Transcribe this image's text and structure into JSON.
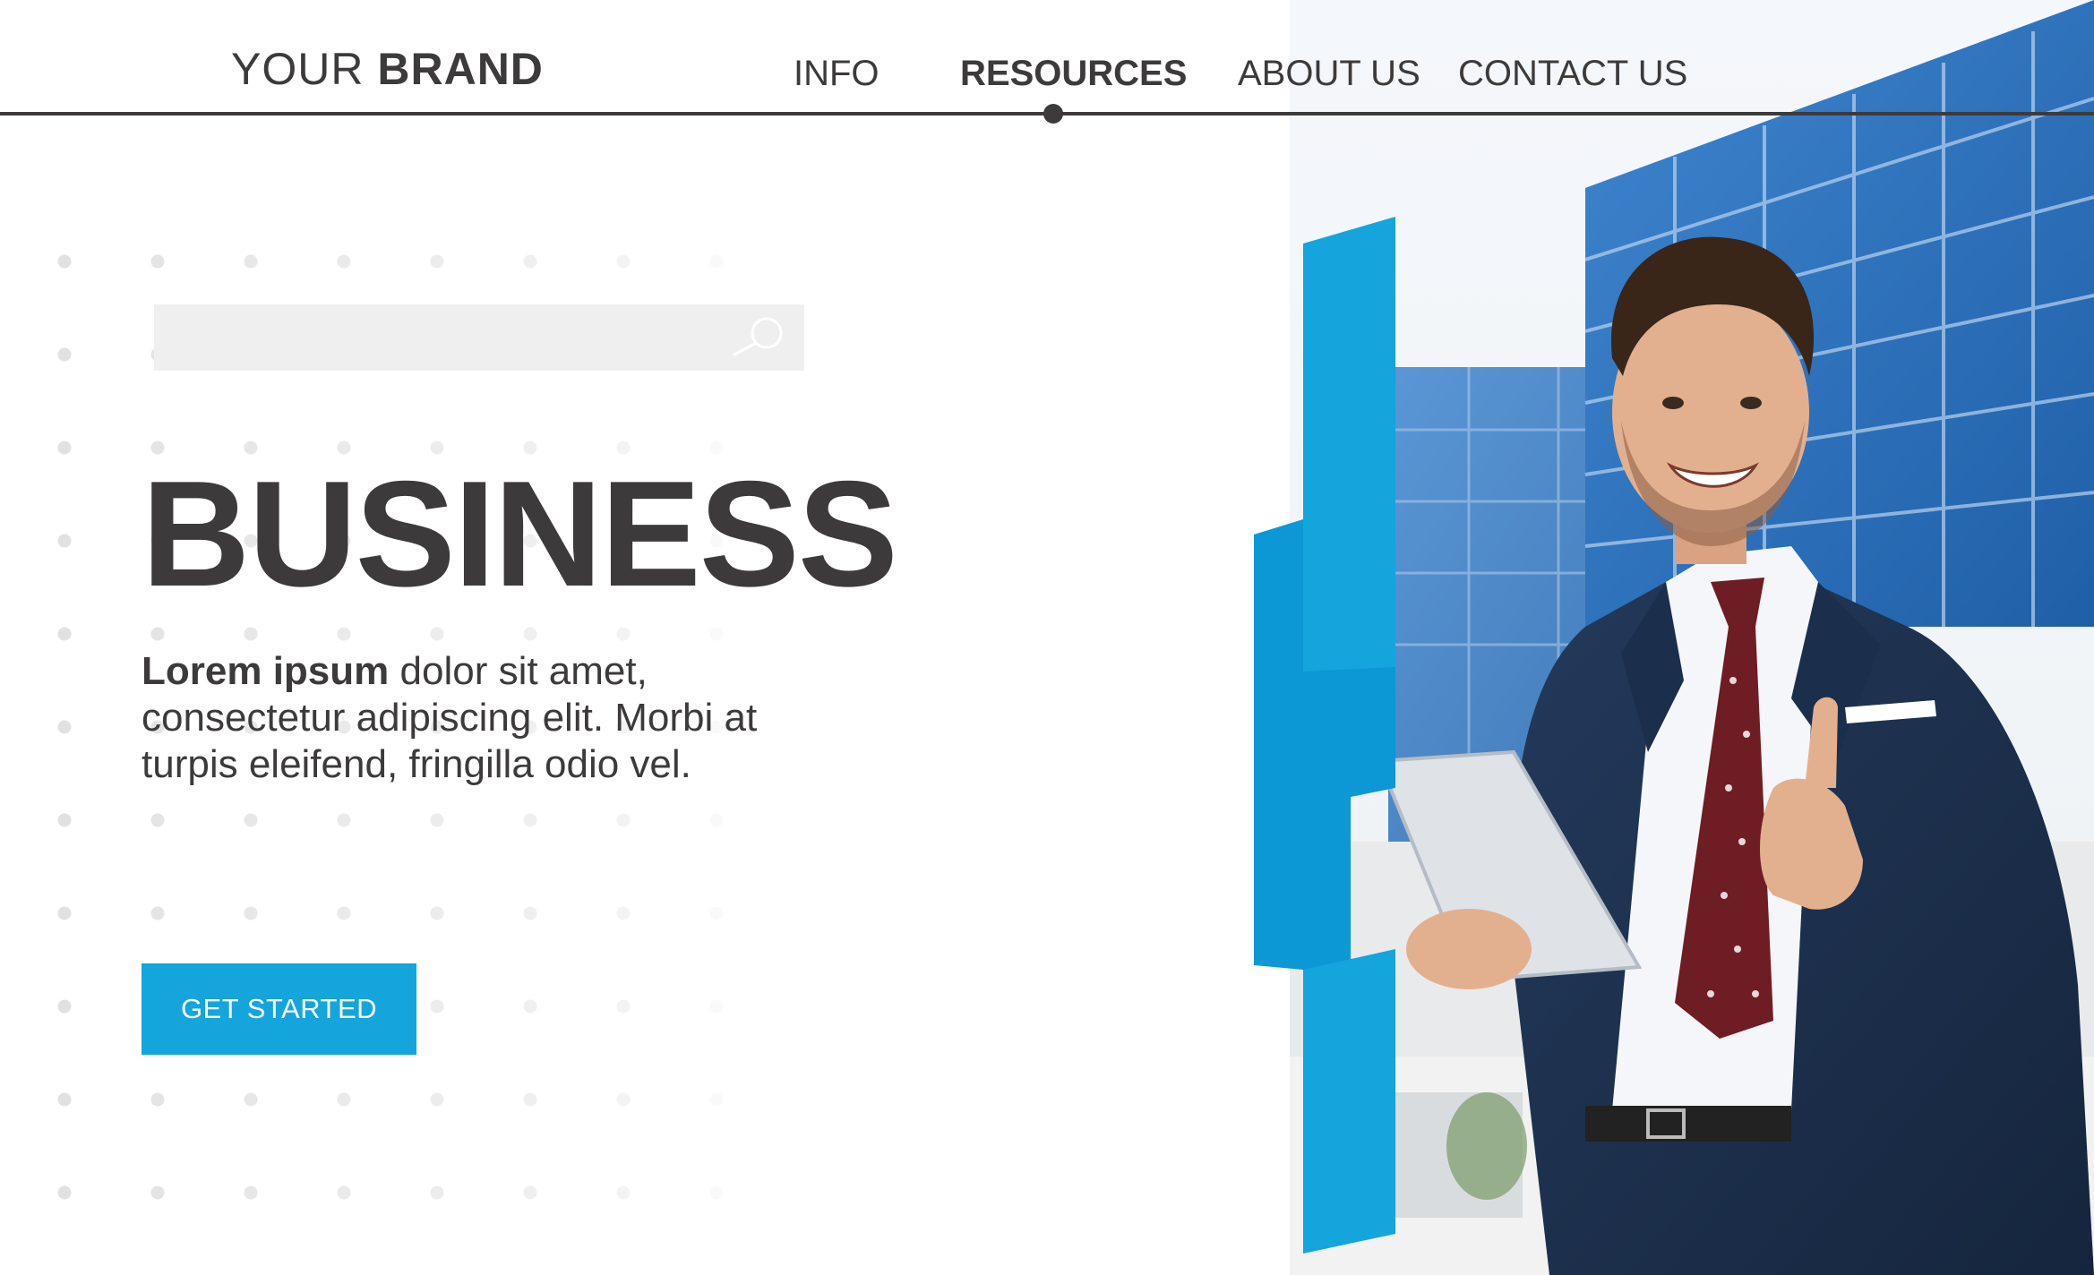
{
  "brand": {
    "light": "YOUR",
    "bold": "BRAND"
  },
  "nav": {
    "items": [
      {
        "label": "INFO",
        "active": false
      },
      {
        "label": "RESOURCES",
        "active": true
      },
      {
        "label": "ABOUT US",
        "active": false
      },
      {
        "label": "CONTACT US",
        "active": false
      }
    ]
  },
  "search": {
    "placeholder": "",
    "value": "",
    "icon": "search-icon"
  },
  "hero": {
    "headline": "BUSINESS",
    "body_strong": "Lorem ipsum",
    "body_rest": " dolor sit amet, consectetur adipiscing elit. Morbi at turpis eleifend, fringilla odio vel.",
    "cta_label": "GET STARTED"
  },
  "colors": {
    "text": "#3d3a3b",
    "accent": "#13a5dc",
    "search_bg": "#efeff0",
    "background": "#ffffff"
  },
  "photo": {
    "subject": "businessman-thumbs-up-photo"
  }
}
